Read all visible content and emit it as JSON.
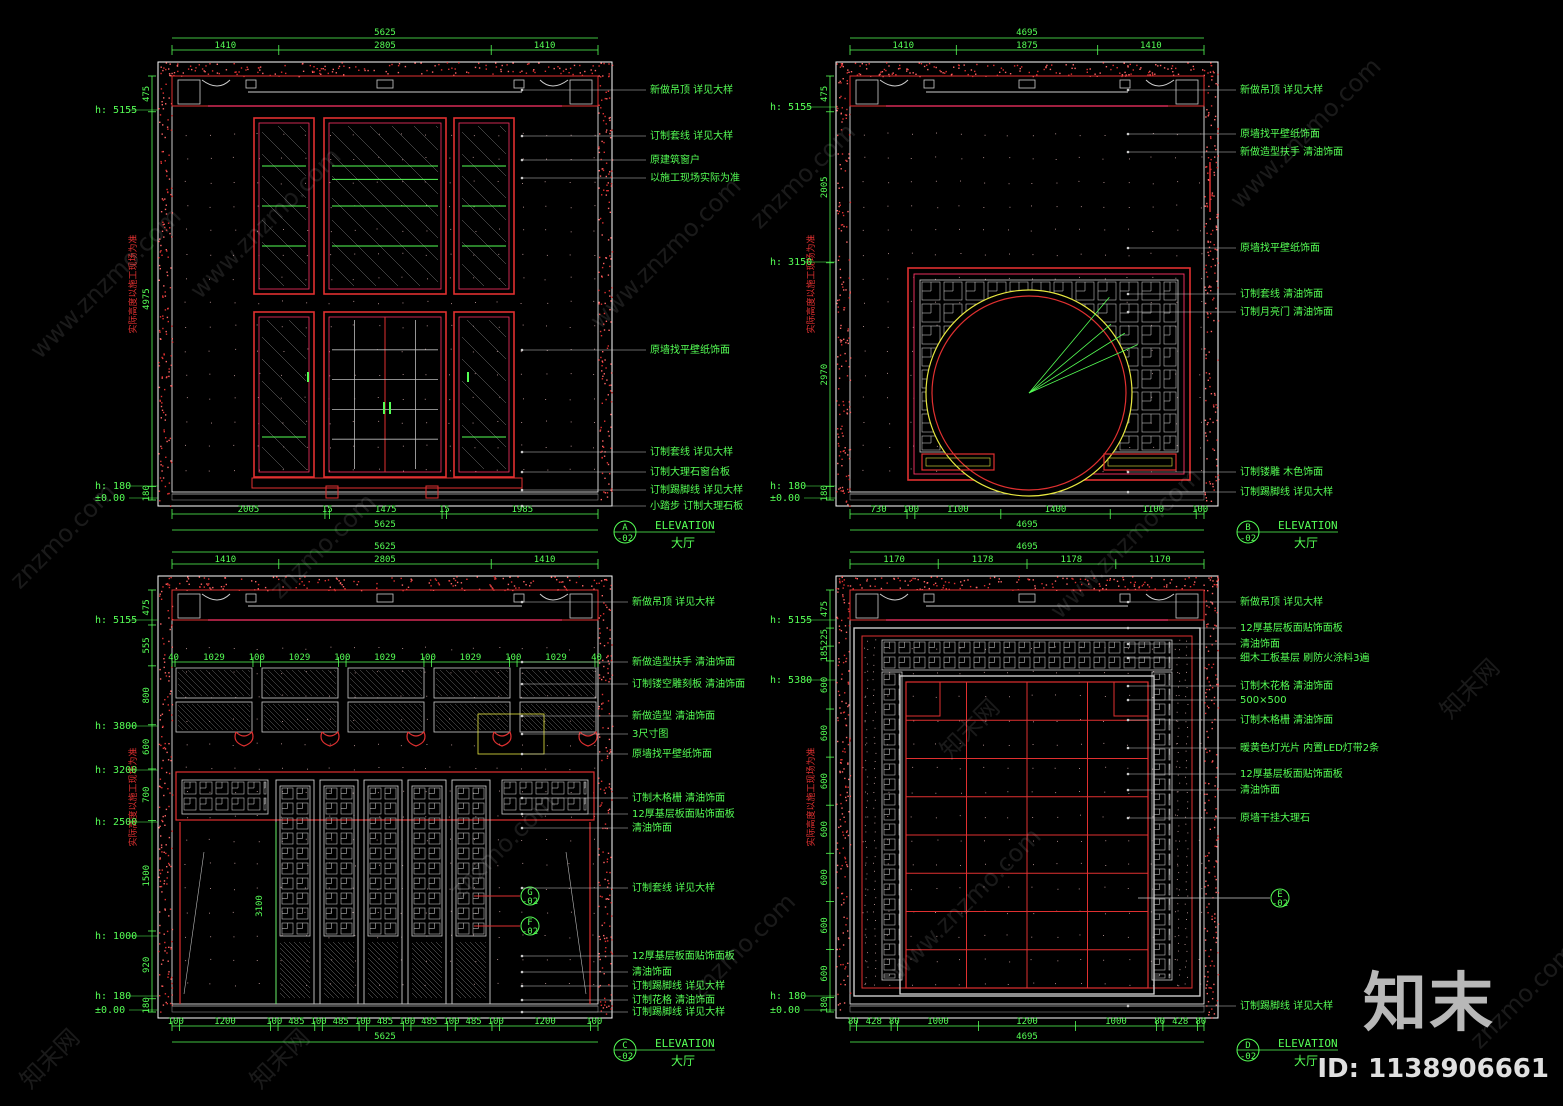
{
  "watermark": {
    "site": "www.znzmo.com",
    "site_short": "znzmo.com",
    "brand": "知末网",
    "logo": "知末",
    "id_text": "ID: 1138906661"
  },
  "colors": {
    "green": "#55ff55",
    "red": "#e03030",
    "magenta": "#ff3366",
    "yellow": "#e8e840",
    "white": "#ffffff"
  },
  "vertical_note": "实际高度以施工现场为准",
  "panels": [
    {
      "key": "A",
      "top_total": "5625",
      "top_dims": [
        "1410",
        "2805",
        "1410"
      ],
      "left_dims": [
        "475",
        "4975",
        "180"
      ],
      "levels": [
        "h: 5155",
        "h: 180",
        "±0.00"
      ],
      "bottom_dims": [
        "2005",
        "15",
        "1475",
        "15",
        "1985"
      ],
      "bottom_total": "5625",
      "callouts": [
        "新做吊顶  详见大样",
        "订制套线  详见大样",
        "原建筑窗户",
        "以施工现场实际为准",
        "原墙找平壁纸饰面",
        "订制套线  详见大样",
        "订制大理石窗台板",
        "订制踢脚线  详见大样",
        "小踏步  订制大理石板"
      ],
      "tag_letter": "A",
      "tag_num": "-02",
      "tag_word": "ELEVATION",
      "room": "大厅"
    },
    {
      "key": "B",
      "top_total": "4695",
      "top_dims": [
        "1410",
        "1875",
        "1410"
      ],
      "left_dims": [
        "475",
        "2005",
        "2970",
        "180"
      ],
      "levels": [
        "h: 5155",
        "h: 3150",
        "h: 180",
        "±0.00"
      ],
      "bottom_dims": [
        "730",
        "100",
        "1100",
        "1400",
        "1100",
        "100"
      ],
      "bottom_total": "4695",
      "callouts": [
        "新做吊顶  详见大样",
        "原墙找平壁纸饰面",
        "新做造型扶手  清油饰面",
        "原墙找平壁纸饰面",
        "订制套线  清油饰面",
        "订制月亮门  清油饰面",
        "订制镂雕  木色饰面",
        "订制踢脚线  详见大样"
      ],
      "tag_letter": "B",
      "tag_num": "-02",
      "tag_word": "ELEVATION",
      "room": "大厅"
    },
    {
      "key": "C",
      "top_total": "5625",
      "top_dims": [
        "1410",
        "2805",
        "1410"
      ],
      "mid_dims": [
        "40",
        "1029",
        "100",
        "1029",
        "100",
        "1029",
        "100",
        "1029",
        "100",
        "1029",
        "40"
      ],
      "left_dims": [
        "475",
        "555",
        "800",
        "600",
        "700",
        "1500",
        "920",
        "180"
      ],
      "levels": [
        "h: 5155",
        "h: 3800",
        "h: 3200",
        "h: 2500",
        "h: 1000",
        "h: 180",
        "±0.00"
      ],
      "height_dim": "3100",
      "bottom_dims": [
        "100",
        "1200",
        "100",
        "485",
        "100",
        "485",
        "100",
        "485",
        "100",
        "485",
        "100",
        "485",
        "100",
        "1200",
        "100"
      ],
      "bottom_total": "5625",
      "callouts": [
        "新做吊顶  详见大样",
        "新做造型扶手  清油饰面",
        "订制镂空雕刻板  清油饰面",
        "新做造型  清油饰面",
        "3尺寸图",
        "原墙找平壁纸饰面",
        "订制木格栅  清油饰面",
        "12厚基层板面贴饰面板",
        "清油饰面",
        "订制套线  详见大样",
        "12厚基层板面贴饰面板",
        "清油饰面",
        "订制踢脚线  详见大样",
        "订制花格  清油饰面",
        "订制踢脚线  详见大样"
      ],
      "section_g": "G",
      "section_f": "F",
      "section_num": "-02",
      "tag_letter": "C",
      "tag_num": "-02",
      "tag_word": "ELEVATION",
      "room": "大厅"
    },
    {
      "key": "D",
      "top_total": "4695",
      "top_dims": [
        "1170",
        "1178",
        "1178",
        "1170"
      ],
      "left_dims": [
        "475",
        "225",
        "185",
        "600",
        "600",
        "600",
        "600",
        "600",
        "600",
        "600",
        "180"
      ],
      "levels": [
        "h: 5155",
        "h: 5380",
        "h: 180",
        "±0.00"
      ],
      "bottom_dims": [
        "80",
        "428",
        "80",
        "1000",
        "1200",
        "1000",
        "80",
        "428",
        "80"
      ],
      "bottom_total": "4695",
      "callouts": [
        "新做吊顶  详见大样",
        "12厚基层板面贴饰面板",
        "清油饰面",
        "细木工板基层  刷防火涂料3遍",
        "订制木花格  清油饰面",
        "500×500",
        "订制木格栅  清油饰面",
        "暖黄色灯光片  内置LED灯带2条",
        "12厚基层板面贴饰面板",
        "清油饰面",
        "原墙干挂大理石",
        "订制踢脚线  详见大样"
      ],
      "section_e": "E",
      "section_num": "-02",
      "tag_letter": "D",
      "tag_num": "-02",
      "tag_word": "ELEVATION",
      "room": "大厅"
    }
  ]
}
